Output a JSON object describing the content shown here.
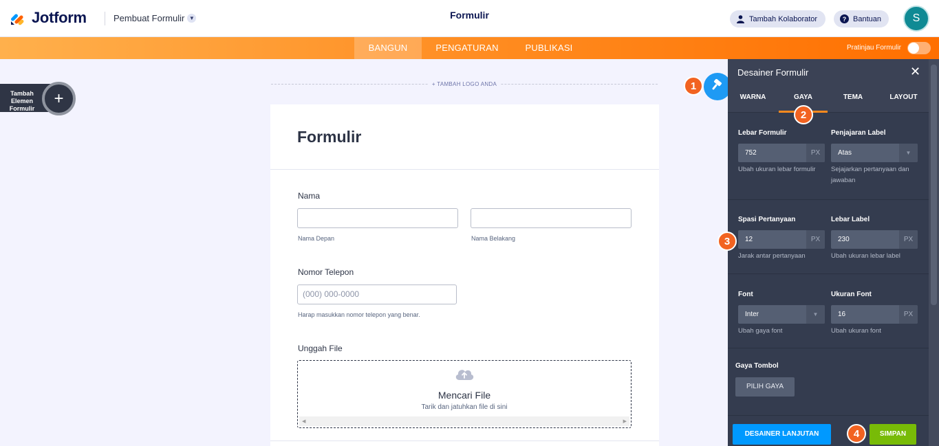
{
  "header": {
    "logo_text": "Jotform",
    "form_maker_label": "Pembuat Formulir",
    "page_title": "Formulir",
    "collaborator_label": "Tambah Kolaborator",
    "help_label": "Bantuan",
    "avatar_initial": "S"
  },
  "nav": {
    "tabs": [
      {
        "label": "BANGUN",
        "active": true
      },
      {
        "label": "PENGATURAN",
        "active": false
      },
      {
        "label": "PUBLIKASI",
        "active": false
      }
    ],
    "preview_label": "Pratinjau Formulir",
    "preview_on": false
  },
  "left": {
    "add_element_label": "Tambah Elemen Formulir"
  },
  "form": {
    "add_logo_label": "+ TAMBAH LOGO ANDA",
    "title": "Formulir",
    "fields": {
      "name_label": "Nama",
      "first_name_sub": "Nama Depan",
      "last_name_sub": "Nama Belakang",
      "phone_label": "Nomor Telepon",
      "phone_placeholder": "(000) 000-0000",
      "phone_sub": "Harap masukkan nomor telepon yang benar.",
      "upload_label": "Unggah File",
      "upload_title": "Mencari File",
      "upload_sub": "Tarik dan jatuhkan file di sini"
    }
  },
  "badges": [
    "1",
    "2",
    "3",
    "4"
  ],
  "designer": {
    "title": "Desainer Formulir",
    "tabs": [
      {
        "label": "WARNA",
        "active": false
      },
      {
        "label": "GAYA",
        "active": true
      },
      {
        "label": "TEMA",
        "active": false
      },
      {
        "label": "LAYOUT",
        "active": false
      }
    ],
    "form_width": {
      "label": "Lebar Formulir",
      "value": "752",
      "unit": "PX",
      "help": "Ubah ukuran lebar formulir"
    },
    "label_align": {
      "label": "Penjajaran Label",
      "value": "Atas",
      "help": "Sejajarkan pertanyaan dan jawaban"
    },
    "question_spacing": {
      "label": "Spasi Pertanyaan",
      "value": "12",
      "unit": "PX",
      "help": "Jarak antar pertanyaan"
    },
    "label_width": {
      "label": "Lebar Label",
      "value": "230",
      "unit": "PX",
      "help": "Ubah ukuran lebar label"
    },
    "font": {
      "label": "Font",
      "value": "Inter",
      "help": "Ubah gaya font"
    },
    "font_size": {
      "label": "Ukuran Font",
      "value": "16",
      "unit": "PX",
      "help": "Ubah ukuran font"
    },
    "button_style": {
      "label": "Gaya Tombol",
      "button": "PILIH GAYA"
    },
    "advanced_button": "DESAINER LANJUTAN",
    "save_button": "SIMPAN"
  },
  "colors": {
    "brand_orange": "#ff8a1e",
    "accent_blue": "#0099ff",
    "save_green": "#78bb07",
    "badge_orange": "#f26321",
    "panel_dark": "#343c4f"
  },
  "icons": [
    "jotform-logo-icon",
    "chevron-down-icon",
    "user-icon",
    "help-icon",
    "plus-icon",
    "paint-roller-icon",
    "close-icon",
    "cloud-upload-icon",
    "caret-down-icon"
  ]
}
